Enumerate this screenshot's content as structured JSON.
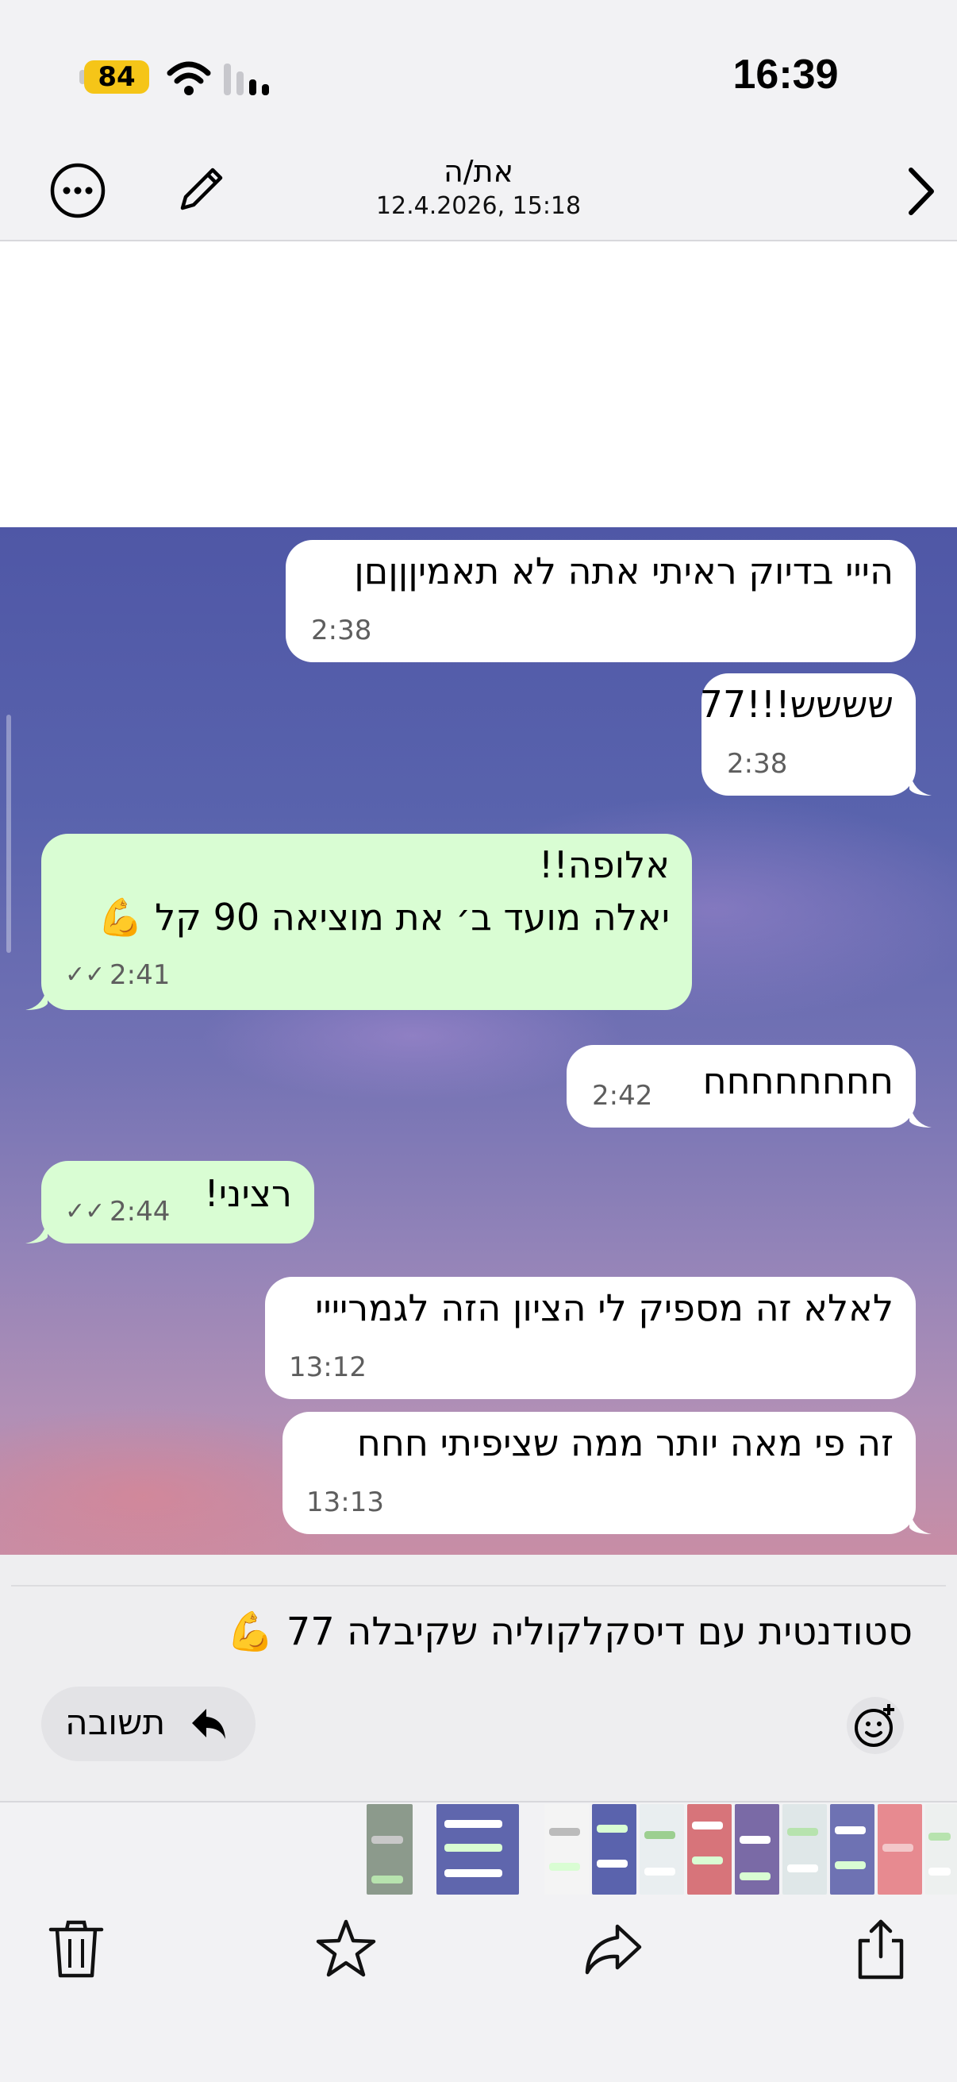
{
  "status": {
    "battery": "84",
    "time": "16:39"
  },
  "header": {
    "title": "את/ה",
    "subtitle": "12.4.2026, 15:18"
  },
  "messages": [
    {
      "text": "הייי בדיוק ראיתי אתה לא תאמיןןןםן",
      "time": "2:38",
      "type": "incoming"
    },
    {
      "text": "שששש!!!77",
      "time": "2:38",
      "type": "incoming"
    },
    {
      "text": "אלופה!!",
      "text2": "יאלה מועד ב׳ את מוציאה 90 קל 💪",
      "time": "2:41",
      "type": "outgoing",
      "read": true
    },
    {
      "text": "חחחחחחחח",
      "time": "2:42",
      "type": "incoming"
    },
    {
      "text": "רציני!",
      "time": "2:44",
      "type": "outgoing",
      "read": true
    },
    {
      "text": "לאלא זה מספיק לי הציון הזה לגמריייי",
      "time": "13:12",
      "type": "incoming"
    },
    {
      "text": "זה פי מאה יותר ממה שציפיתי חחח",
      "time": "13:13",
      "type": "incoming"
    }
  ],
  "quote": {
    "text": "סטודנטית עם דיסקלקוליה שקיבלה 77 💪"
  },
  "reply": {
    "label": "תשובה"
  },
  "colors": {
    "incoming_bubble": "#ffffff",
    "outgoing_bubble": "#d9fdd3",
    "battery": "#f5c518"
  },
  "icons": {
    "nav": [
      "more-icon",
      "edit-icon",
      "chevron-right-icon"
    ],
    "toolbar": [
      "trash-icon",
      "star-icon",
      "forward-icon",
      "share-icon"
    ],
    "reply": [
      "reply-arrow-icon",
      "emoji-add-icon"
    ]
  }
}
